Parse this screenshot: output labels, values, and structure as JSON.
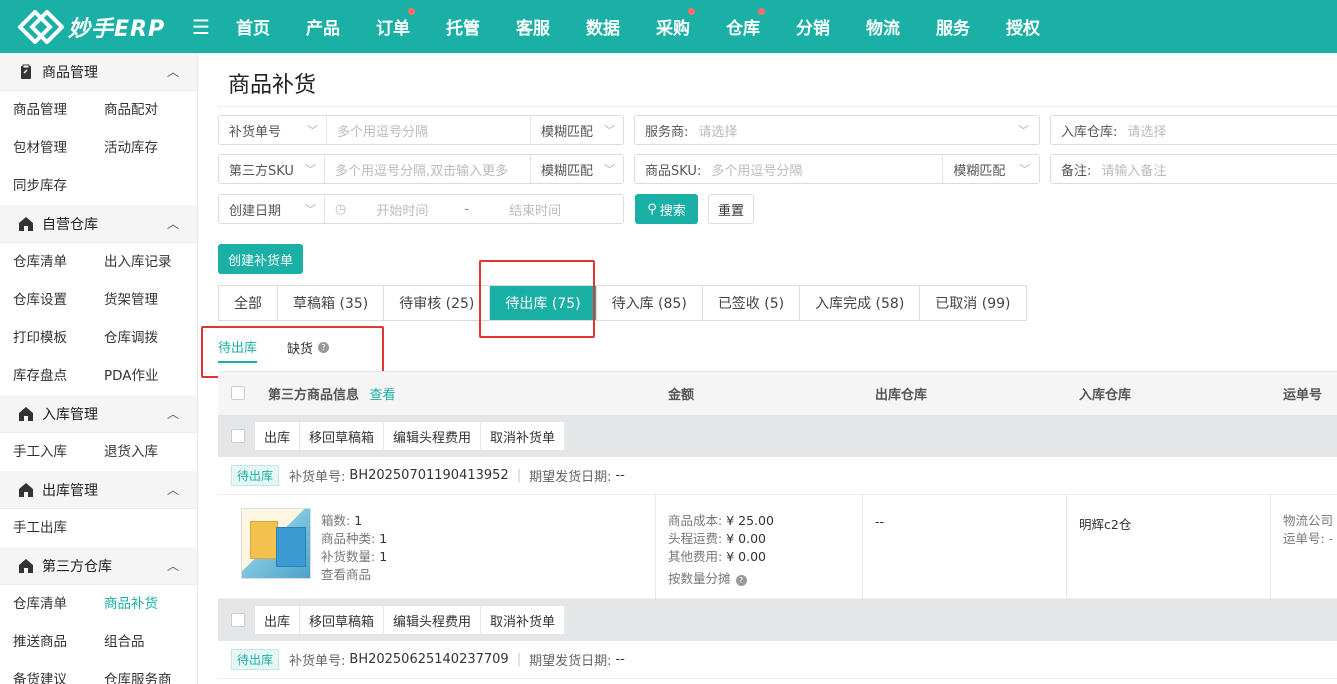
{
  "app": {
    "logo_text": "妙手ERP"
  },
  "nav": [
    {
      "label": "首页",
      "dot": false
    },
    {
      "label": "产品",
      "dot": false
    },
    {
      "label": "订单",
      "dot": true
    },
    {
      "label": "托管",
      "dot": false
    },
    {
      "label": "客服",
      "dot": false
    },
    {
      "label": "数据",
      "dot": false
    },
    {
      "label": "采购",
      "dot": true
    },
    {
      "label": "仓库",
      "dot": true
    },
    {
      "label": "分销",
      "dot": false
    },
    {
      "label": "物流",
      "dot": false
    },
    {
      "label": "服务",
      "dot": false
    },
    {
      "label": "授权",
      "dot": false
    }
  ],
  "sidebar": {
    "groups": [
      {
        "title": "商品管理",
        "icon": "clipboard-icon",
        "items": [
          "商品管理",
          "商品配对",
          "包材管理",
          "活动库存",
          "同步库存"
        ]
      },
      {
        "title": "自营仓库",
        "icon": "warehouse-icon",
        "items": [
          "仓库清单",
          "出入库记录",
          "仓库设置",
          "货架管理",
          "打印模板",
          "仓库调拨",
          "库存盘点",
          "PDA作业"
        ]
      },
      {
        "title": "入库管理",
        "icon": "warehouse-icon",
        "items": [
          "手工入库",
          "退货入库"
        ]
      },
      {
        "title": "出库管理",
        "icon": "warehouse-icon",
        "items": [
          "手工出库"
        ]
      },
      {
        "title": "第三方仓库",
        "icon": "warehouse-icon",
        "items": [
          "仓库清单",
          "商品补货",
          "推送商品",
          "组合品",
          "备货建议",
          "仓库服务商"
        ]
      }
    ]
  },
  "page": {
    "title": "商品补货"
  },
  "filters": {
    "restock_no_select": "补货单号",
    "restock_no_placeholder": "多个用逗号分隔",
    "match_mode_1": "模糊匹配",
    "provider_label": "服务商:",
    "provider_placeholder": "请选择",
    "inbound_wh_label": "入库仓库:",
    "inbound_wh_placeholder": "请选择",
    "third_sku_select": "第三方SKU",
    "third_sku_placeholder": "多个用逗号分隔,双击输入更多",
    "match_mode_2": "模糊匹配",
    "product_sku_label": "商品SKU:",
    "product_sku_placeholder": "多个用逗号分隔",
    "match_mode_3": "模糊匹配",
    "remark_label": "备注:",
    "remark_placeholder": "请输入备注",
    "date_select": "创建日期",
    "start_placeholder": "开始时间",
    "date_sep": "-",
    "end_placeholder": "结束时间",
    "search_label": "搜索",
    "reset_label": "重置"
  },
  "create_button": "创建补货单",
  "tabs": [
    {
      "label": "全部",
      "active": false
    },
    {
      "label": "草稿箱 (35)",
      "active": false
    },
    {
      "label": "待审核 (25)",
      "active": false
    },
    {
      "label": "待出库 (75)",
      "active": true
    },
    {
      "label": "待入库 (85)",
      "active": false
    },
    {
      "label": "已签收 (5)",
      "active": false
    },
    {
      "label": "入库完成 (58)",
      "active": false
    },
    {
      "label": "已取消 (99)",
      "active": false
    }
  ],
  "subtabs": {
    "pending_out": "待出库",
    "shortage": "缺货"
  },
  "table": {
    "col_product": "第三方商品信息",
    "col_product_link": "查看",
    "col_amount": "金额",
    "col_out_wh": "出库仓库",
    "col_in_wh": "入库仓库",
    "col_tracking": "运单号"
  },
  "actions": [
    "出库",
    "移回草稿箱",
    "编辑头程费用",
    "取消补货单"
  ],
  "orders": [
    {
      "status": "待出库",
      "restock_label": "补货单号:",
      "restock_no": "BH20250701190413952",
      "ship_date_label": "期望发货日期:",
      "ship_date": "--",
      "boxes_label": "箱数:",
      "boxes": "1",
      "kinds_label": "商品种类:",
      "kinds": "1",
      "qty_label": "补货数量:",
      "qty": "1",
      "view_goods": "查看商品",
      "cost_label": "商品成本:",
      "cost": "¥ 25.00",
      "freight_label": "头程运费:",
      "freight": "¥ 0.00",
      "other_label": "其他费用:",
      "other": "¥ 0.00",
      "split_label": "按数量分摊",
      "out_wh": "--",
      "in_wh": "明辉c2仓",
      "logistics_label": "物流公司",
      "tracking_label": "运单号: -"
    },
    {
      "status": "待出库",
      "restock_label": "补货单号:",
      "restock_no": "BH20250625140237709",
      "ship_date_label": "期望发货日期:",
      "ship_date": "--"
    }
  ]
}
